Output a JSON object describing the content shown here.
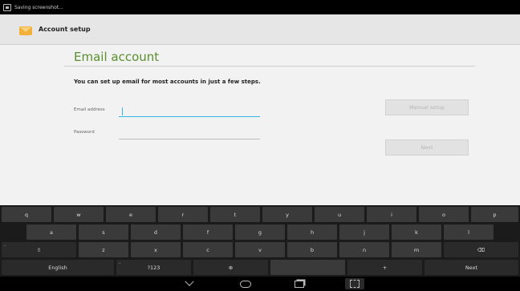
{
  "status_bar": {
    "text": "Saving screenshot..."
  },
  "action_bar": {
    "title": "Account setup"
  },
  "form": {
    "heading": "Email account",
    "intro": "You can set up email for most accounts in just a few steps.",
    "email_label": "Email address",
    "email_value": "",
    "password_label": "Password",
    "password_value": "",
    "manual_setup_label": "Manual setup",
    "next_label": "Next"
  },
  "keyboard": {
    "row1": [
      "q",
      "w",
      "e",
      "r",
      "t",
      "y",
      "u",
      "i",
      "o",
      "p"
    ],
    "row2": [
      "a",
      "s",
      "d",
      "f",
      "g",
      "h",
      "j",
      "k",
      "l"
    ],
    "row3": [
      "z",
      "x",
      "c",
      "v",
      "b",
      "n",
      "m"
    ],
    "shift_label": "⇧",
    "delete_label": "⌫",
    "english_label": "English",
    "symbols_label": "?123",
    "globe_label": "⊕",
    "next_key_label": "Next",
    "plus_label": "+"
  },
  "colors": {
    "accent": "#33b5e5",
    "heading": "#5a8f2e",
    "keyboard_bg": "#1b1b1b",
    "key": "#3a3a3a"
  }
}
